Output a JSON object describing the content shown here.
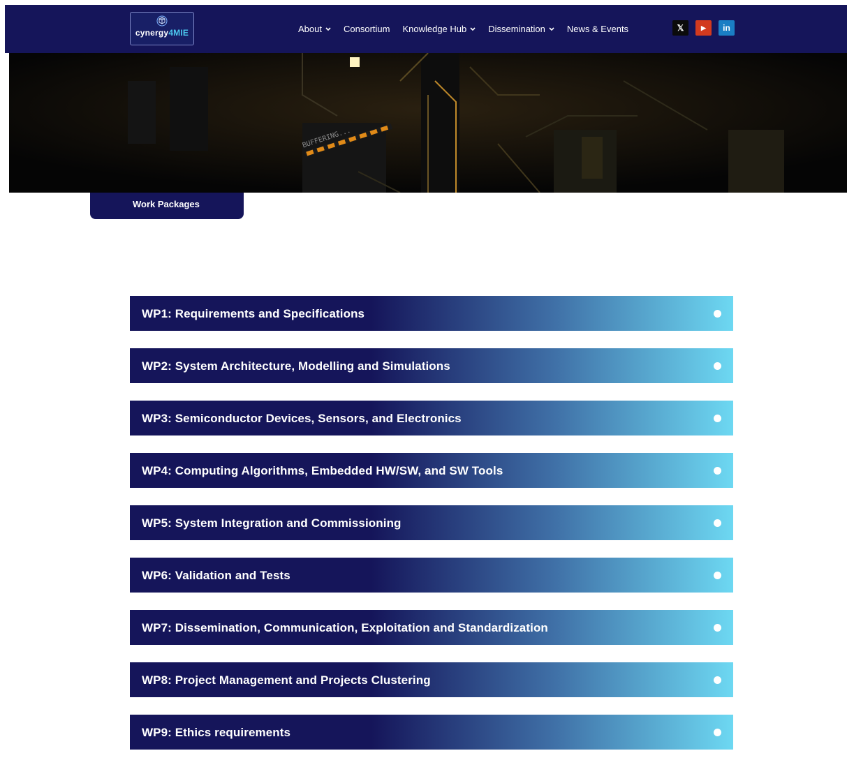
{
  "header": {
    "logo_text_main": "cynergy",
    "logo_text_accent": "4MIE",
    "nav": [
      {
        "label": "About",
        "has_dropdown": true
      },
      {
        "label": "Consortium",
        "has_dropdown": false
      },
      {
        "label": "Knowledge Hub",
        "has_dropdown": true
      },
      {
        "label": "Dissemination",
        "has_dropdown": true
      },
      {
        "label": "News & Events",
        "has_dropdown": false
      }
    ],
    "social": [
      {
        "icon": "x-twitter-icon",
        "glyph": "𝕏"
      },
      {
        "icon": "youtube-icon",
        "glyph": "▶"
      },
      {
        "icon": "linkedin-icon",
        "glyph": "in"
      }
    ]
  },
  "hero": {
    "text_in_image": "BUFFERING..."
  },
  "tag_label": "Work Packages",
  "work_packages": [
    "WP1: Requirements and Specifications",
    "WP2: System Architecture, Modelling and Simulations",
    "WP3: Semiconductor Devices, Sensors, and Electronics",
    "WP4: Computing Algorithms, Embedded HW/SW, and SW Tools",
    "WP5: System Integration and Commissioning",
    "WP6: Validation and Tests",
    "WP7: Dissemination, Communication, Exploitation and Standardization",
    "WP8: Project Management and Projects Clustering",
    "WP9: Ethics requirements"
  ],
  "colors": {
    "navy": "#15155a",
    "accent_cyan": "#6dd8f2",
    "youtube_red": "#d23a1e",
    "linkedin_blue": "#1a7ec4"
  }
}
